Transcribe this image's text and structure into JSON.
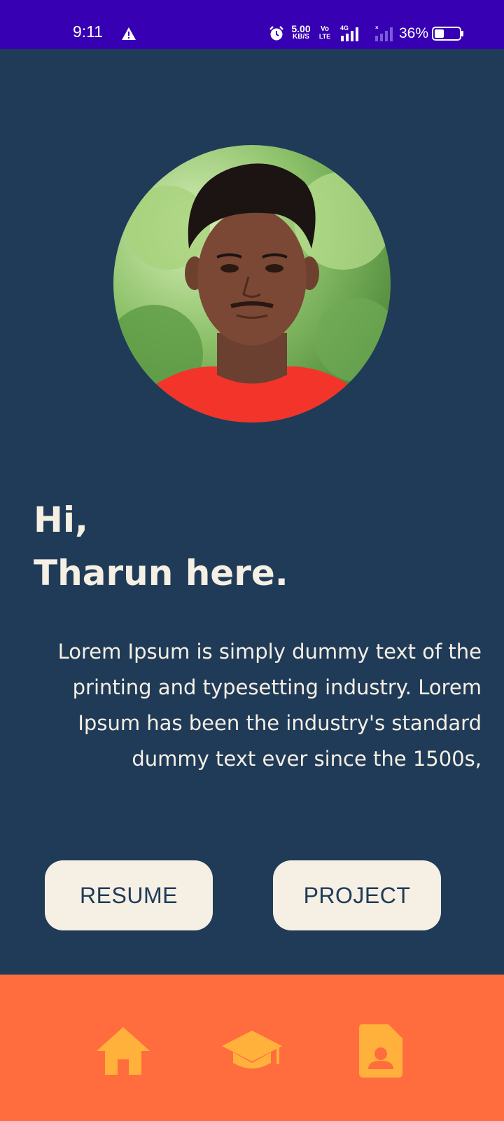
{
  "status_bar": {
    "time": "9:11",
    "net_speed_value": "5.00",
    "net_speed_unit": "KB/S",
    "volte_top": "Vo",
    "volte_bottom": "LTE",
    "network_type": "4G",
    "battery": "36%",
    "background_color": "#3700B3",
    "icons": [
      "warning-icon",
      "alarm-icon",
      "signal-4g-icon",
      "signal-sim2-icon",
      "battery-icon"
    ]
  },
  "profile": {
    "avatar": "profile-photo",
    "greeting_line1": "Hi,",
    "greeting_line2": "Tharun here.",
    "bio": "Lorem Ipsum is simply dummy  text of the printing and typesetting industry. Lorem Ipsum has been the industry's standard dummy text ever since the 1500s,"
  },
  "actions": {
    "resume_label": "RESUME",
    "project_label": "PROJECT"
  },
  "bottom_nav": {
    "items": [
      {
        "icon": "home-icon"
      },
      {
        "icon": "graduation-cap-icon"
      },
      {
        "icon": "contact-card-icon"
      }
    ]
  },
  "colors": {
    "background": "#203B58",
    "text_cream": "#F5EFE4",
    "nav_background": "#FF6D3F",
    "nav_icon": "#FFB13B"
  }
}
